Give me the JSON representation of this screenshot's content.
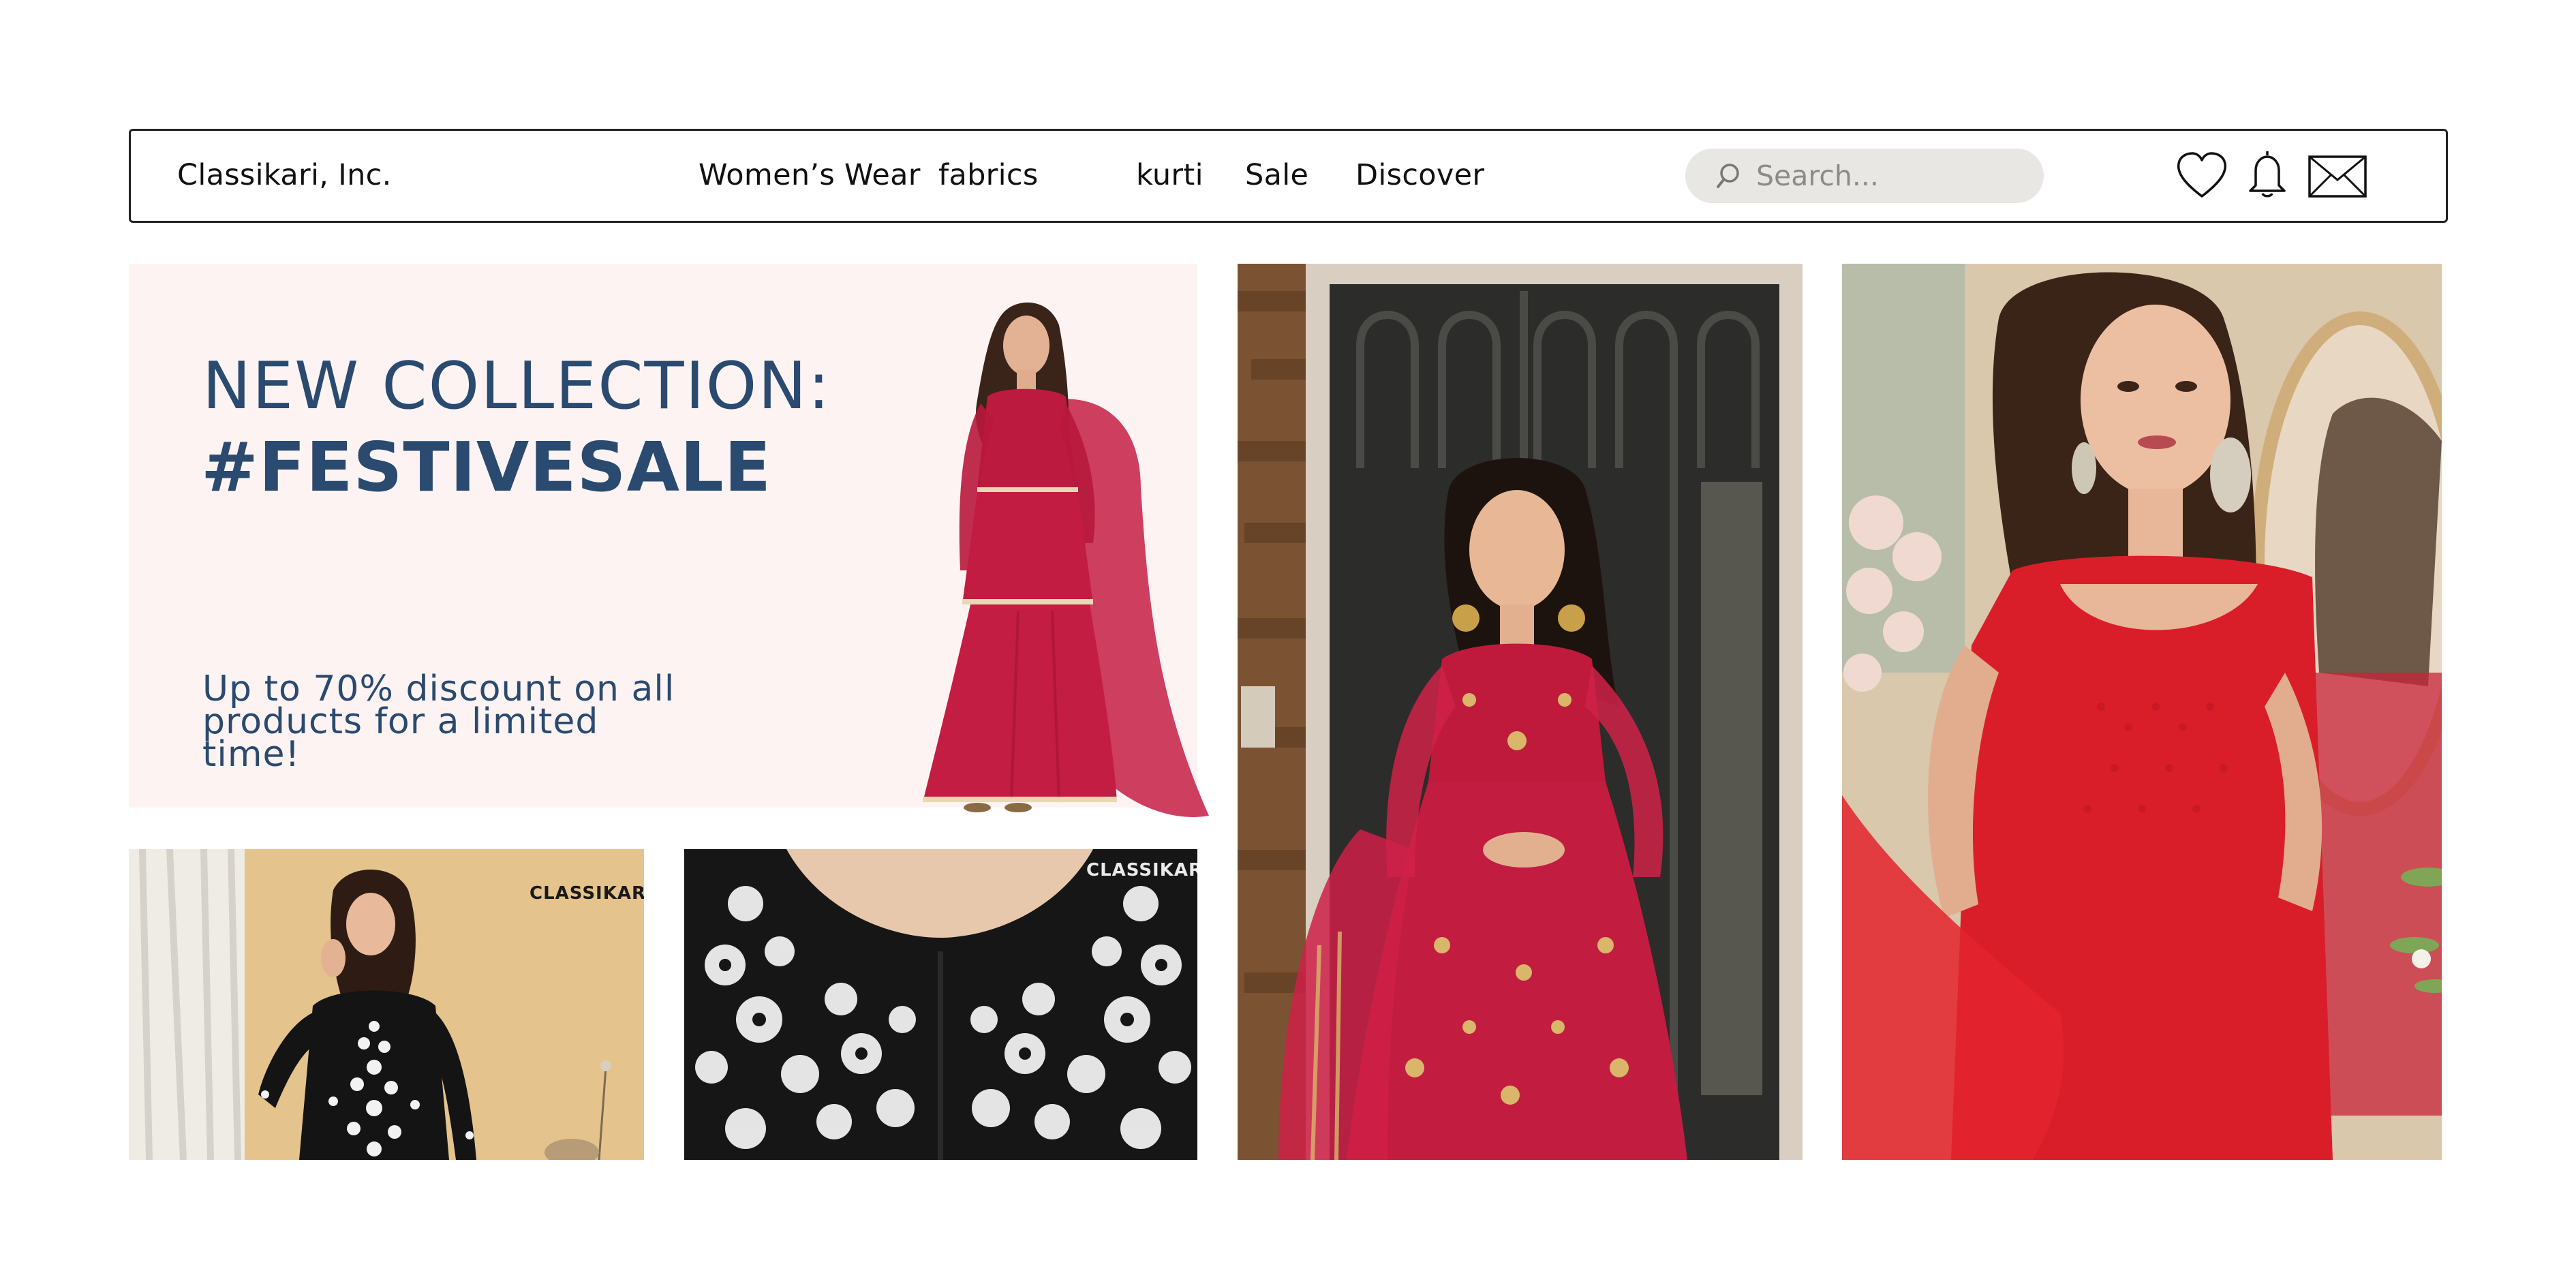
{
  "nav": {
    "brand": "Classikari, Inc.",
    "links": [
      "Women’s Wear",
      "fabrics",
      "kurti",
      "Sale",
      "Discover"
    ],
    "search_placeholder": "Search...",
    "icons": [
      "heart-icon",
      "bell-icon",
      "mail-icon"
    ]
  },
  "hero": {
    "line1": "NEW COLLECTION:",
    "line2": "#FESTIVESALE",
    "subtitle": "Up to 70% discount on all products for a limited time!"
  },
  "colors": {
    "hero_bg": "#fdf3f3",
    "hero_text": "#2a4a6f",
    "search_bg": "#e9e7e3",
    "dress_red": "#c0193a",
    "kurti_black": "#161616"
  },
  "watermarks": [
    "CLASSIKARI",
    "CLASSIKARI"
  ]
}
